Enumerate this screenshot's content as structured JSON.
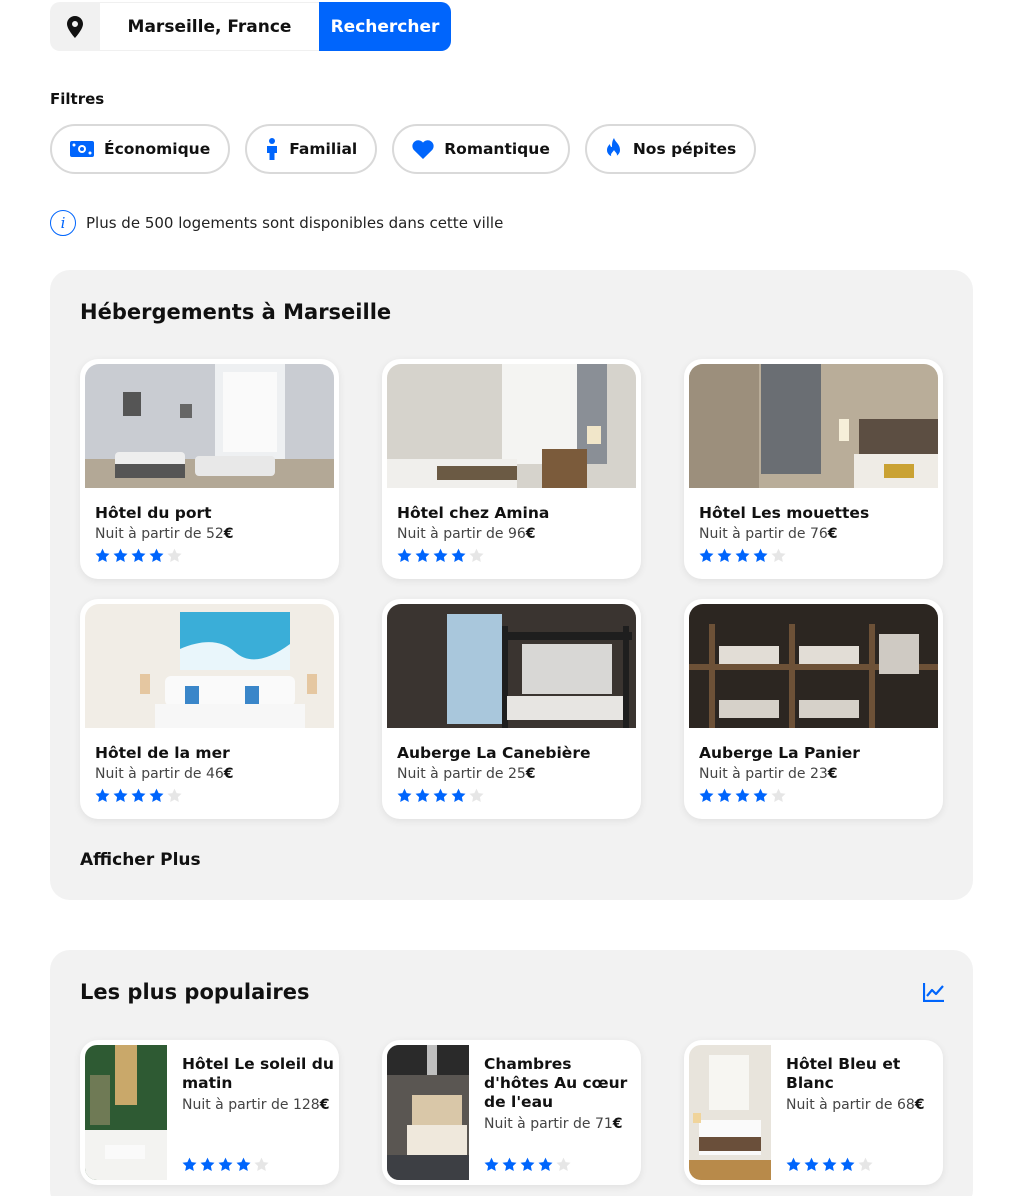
{
  "search": {
    "city": "Marseille, France",
    "button_label": "Rechercher",
    "icon": "location-pin-icon"
  },
  "filters": {
    "title": "Filtres",
    "chips": [
      {
        "label": "Économique",
        "icon": "money-icon"
      },
      {
        "label": "Familial",
        "icon": "person-icon"
      },
      {
        "label": "Romantique",
        "icon": "heart-icon"
      },
      {
        "label": "Nos pépites",
        "icon": "fire-icon"
      }
    ]
  },
  "info": {
    "icon": "info-icon",
    "text": "Plus de 500 logements sont disponibles dans cette ville"
  },
  "lodgings": {
    "title": "Hébergements à Marseille",
    "price_prefix": "Nuit à partir de",
    "currency": "€",
    "items": [
      {
        "name": "Hôtel du port",
        "price": "52",
        "rating": 4
      },
      {
        "name": "Hôtel chez Amina",
        "price": "96",
        "rating": 4
      },
      {
        "name": "Hôtel Les mouettes",
        "price": "76",
        "rating": 4
      },
      {
        "name": "Hôtel de la mer",
        "price": "46",
        "rating": 4
      },
      {
        "name": "Auberge La Canebière",
        "price": "25",
        "rating": 4
      },
      {
        "name": "Auberge La Panier",
        "price": "23",
        "rating": 4
      }
    ],
    "more_label": "Afficher Plus"
  },
  "popular": {
    "title": "Les plus populaires",
    "icon": "trending-chart-icon",
    "items": [
      {
        "name": "Hôtel Le soleil du matin",
        "price": "128",
        "rating": 4
      },
      {
        "name": "Chambres d'hôtes Au cœur de l'eau",
        "price": "71",
        "rating": 4
      },
      {
        "name": "Hôtel Bleu et Blanc",
        "price": "68",
        "rating": 4
      }
    ]
  },
  "colors": {
    "accent": "#0065fc",
    "section_bg": "#f2f2f2",
    "star_empty": "#e6e6e6"
  }
}
